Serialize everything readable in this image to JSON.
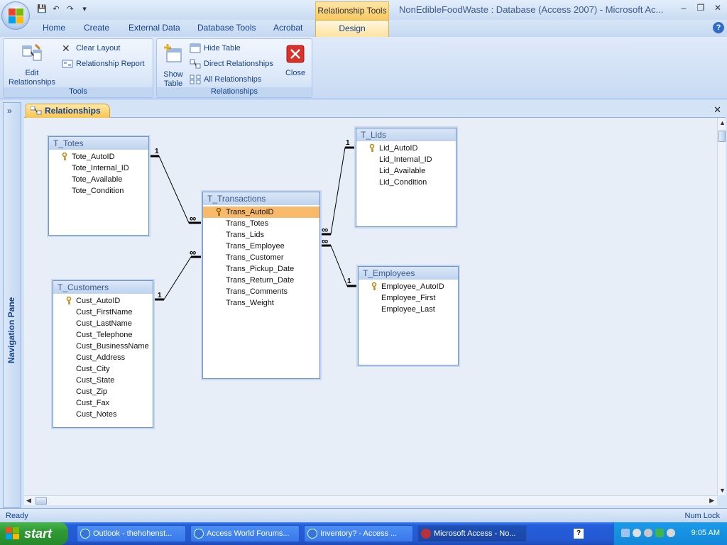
{
  "window": {
    "title": "NonEdibleFoodWaste : Database (Access 2007) - Microsoft Ac...",
    "contextual_tab_group": "Relationship Tools"
  },
  "ribbon": {
    "tabs": [
      "Home",
      "Create",
      "External Data",
      "Database Tools",
      "Acrobat",
      "Design"
    ],
    "groups": {
      "tools": {
        "label": "Tools",
        "edit_relationships": "Edit Relationships",
        "clear_layout": "Clear Layout",
        "relationship_report": "Relationship Report"
      },
      "relationships": {
        "label": "Relationships",
        "show_table": "Show Table",
        "hide_table": "Hide Table",
        "direct_relationships": "Direct Relationships",
        "all_relationships": "All Relationships",
        "close": "Close"
      }
    }
  },
  "nav_pane": {
    "label": "Navigation Pane",
    "toggle": "»"
  },
  "document_tab": {
    "label": "Relationships"
  },
  "tables": [
    {
      "name": "T_Totes",
      "fields": [
        "Tote_AutoID",
        "Tote_Internal_ID",
        "Tote_Available",
        "Tote_Condition"
      ],
      "key": 0
    },
    {
      "name": "T_Transactions",
      "fields": [
        "Trans_AutoID",
        "Trans_Totes",
        "Trans_Lids",
        "Trans_Employee",
        "Trans_Customer",
        "Trans_Pickup_Date",
        "Trans_Return_Date",
        "Trans_Comments",
        "Trans_Weight"
      ],
      "key": 0,
      "selected": 0
    },
    {
      "name": "T_Lids",
      "fields": [
        "Lid_AutoID",
        "Lid_Internal_ID",
        "Lid_Available",
        "Lid_Condition"
      ],
      "key": 0
    },
    {
      "name": "T_Customers",
      "fields": [
        "Cust_AutoID",
        "Cust_FirstName",
        "Cust_LastName",
        "Cust_Telephone",
        "Cust_BusinessName",
        "Cust_Address",
        "Cust_City",
        "Cust_State",
        "Cust_Zip",
        "Cust_Fax",
        "Cust_Notes"
      ],
      "key": 0
    },
    {
      "name": "T_Employees",
      "fields": [
        "Employee_AutoID",
        "Employee_First",
        "Employee_Last"
      ],
      "key": 0
    }
  ],
  "relationships": [
    {
      "from": "T_Totes.Tote_AutoID",
      "to": "T_Transactions.Trans_Totes",
      "one": "1",
      "many": "∞"
    },
    {
      "from": "T_Customers.Cust_AutoID",
      "to": "T_Transactions.Trans_Customer",
      "one": "1",
      "many": "∞"
    },
    {
      "from": "T_Lids.Lid_AutoID",
      "to": "T_Transactions.Trans_Lids",
      "one": "1",
      "many": "∞"
    },
    {
      "from": "T_Employees.Employee_AutoID",
      "to": "T_Transactions.Trans_Employee",
      "one": "1",
      "many": "∞"
    }
  ],
  "status_bar": {
    "left": "Ready",
    "right": "Num Lock"
  },
  "taskbar": {
    "start_label": "start",
    "tasks": [
      {
        "label": "Outlook - thehohenst...",
        "active": false
      },
      {
        "label": "Access World Forums...",
        "active": false
      },
      {
        "label": "Inventory? - Access ...",
        "active": false
      },
      {
        "label": "Microsoft Access - No...",
        "active": true
      }
    ],
    "clock": "9:05 AM"
  },
  "colors": {
    "selected_field": "#f9b96a",
    "ribbon_text": "#15428b",
    "taskbar": "#245edb",
    "start": "#2f9a35"
  }
}
